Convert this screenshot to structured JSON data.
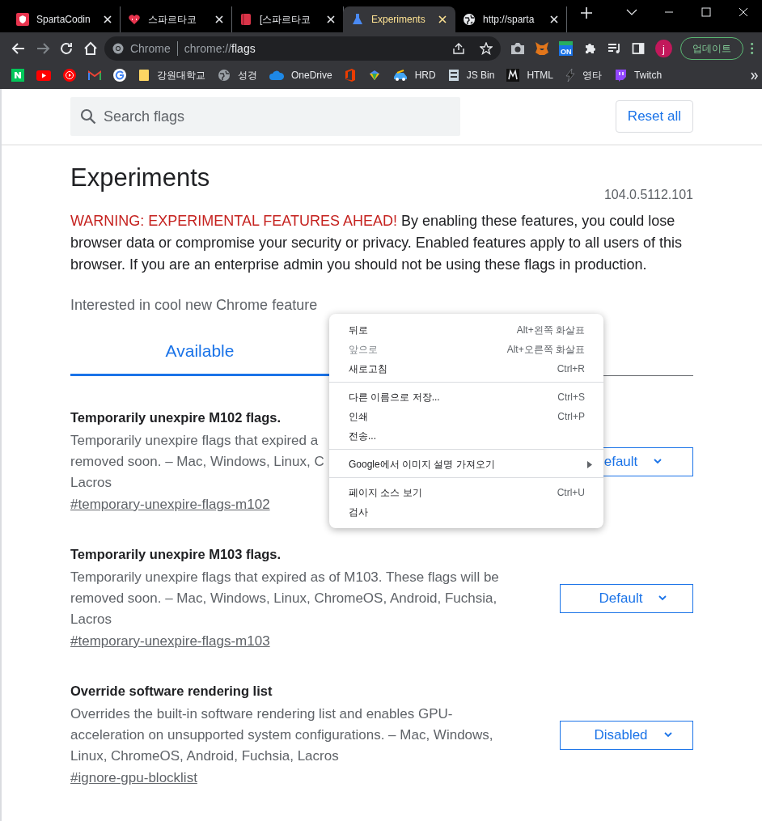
{
  "tabs": [
    {
      "title": "SpartaCodin",
      "selected": false
    },
    {
      "title": "스파르타코",
      "selected": false
    },
    {
      "title": "[스파르타코",
      "selected": false
    },
    {
      "title": "Experiments",
      "selected": true
    },
    {
      "title": "http://sparta",
      "selected": false
    }
  ],
  "toolbar": {
    "back_disabled": false,
    "forward_disabled": true,
    "chip": "Chrome",
    "url_scheme": "chrome://",
    "url_path": "flags",
    "extension_badge": "ON",
    "avatar": "j",
    "update_button": "업데이트"
  },
  "bookmarks": [
    {
      "kind": "icon"
    },
    {
      "kind": "icon"
    },
    {
      "kind": "icon"
    },
    {
      "kind": "icon"
    },
    {
      "kind": "icon"
    },
    {
      "kind": "link",
      "label": "강원대학교"
    },
    {
      "kind": "link",
      "label": "성경"
    },
    {
      "kind": "link",
      "label": "OneDrive"
    },
    {
      "kind": "icon"
    },
    {
      "kind": "icon"
    },
    {
      "kind": "link",
      "label": "HRD"
    },
    {
      "kind": "link",
      "label": "JS Bin"
    },
    {
      "kind": "link",
      "label": "HTML"
    },
    {
      "kind": "link",
      "label": "영타"
    },
    {
      "kind": "link",
      "label": "Twitch"
    }
  ],
  "header": {
    "search_placeholder": "Search flags",
    "reset_button": "Reset all"
  },
  "page": {
    "title": "Experiments",
    "version": "104.0.5112.101",
    "warning_label": "WARNING: EXPERIMENTAL FEATURES AHEAD!",
    "warning_text": "By enabling these features, you could lose browser data or compromise your security or privacy. Enabled features apply to all users of this browser. If you are an enterprise admin you should not be using these flags in production.",
    "interest_text": "Interested in cool new Chrome feature"
  },
  "page_tabs": [
    {
      "label": "Available",
      "selected": true
    }
  ],
  "flags": [
    {
      "title": "Temporarily unexpire M102 flags.",
      "description_lines": [
        "Temporarily unexpire flags that expired a",
        "removed soon. – Mac, Windows, Linux, C",
        "Lacros"
      ],
      "link": "#temporary-unexpire-flags-m102",
      "select": "efault"
    },
    {
      "title": "Temporarily unexpire M103 flags.",
      "description_lines": [
        "Temporarily unexpire flags that expired as of M103. These flags will be",
        "removed soon. – Mac, Windows, Linux, ChromeOS, Android, Fuchsia,",
        "Lacros"
      ],
      "link": "#temporary-unexpire-flags-m103",
      "select": "Default"
    },
    {
      "title": "Override software rendering list",
      "description_lines": [
        "Overrides the built-in software rendering list and enables GPU-",
        "acceleration on unsupported system configurations. – Mac, Windows,",
        "Linux, ChromeOS, Android, Fuchsia, Lacros"
      ],
      "link": "#ignore-gpu-blocklist",
      "select": "Disabled"
    }
  ],
  "context_menu": [
    [
      {
        "label": "뒤로",
        "shortcut": "Alt+왼쪽 화살표",
        "disabled": false
      },
      {
        "label": "앞으로",
        "shortcut": "Alt+오른쪽 화살표",
        "disabled": true
      },
      {
        "label": "새로고침",
        "shortcut": "Ctrl+R",
        "disabled": false
      }
    ],
    [
      {
        "label": "다른 이름으로 저장...",
        "shortcut": "Ctrl+S",
        "disabled": false
      },
      {
        "label": "인쇄",
        "shortcut": "Ctrl+P",
        "disabled": false
      },
      {
        "label": "전송...",
        "disabled": false
      }
    ],
    [
      {
        "label": "Google에서 이미지 설명 가져오기",
        "submenu": true,
        "disabled": false
      }
    ],
    [
      {
        "label": "페이지 소스 보기",
        "shortcut": "Ctrl+U",
        "disabled": false
      },
      {
        "label": "검사",
        "disabled": false
      }
    ]
  ]
}
